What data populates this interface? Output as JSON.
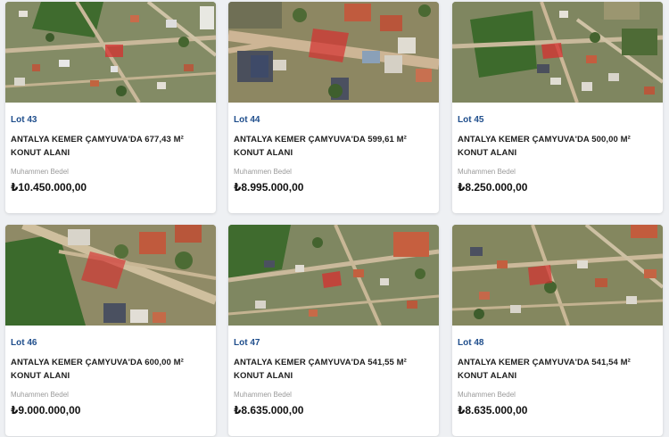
{
  "colors": {
    "lot_number": "#1f4e8c",
    "parcel_highlight": "#d62f2f",
    "background": "#eef0f3"
  },
  "lots": [
    {
      "lot": "Lot 43",
      "title": "ANTALYA KEMER ÇAMYUVA'DA 677,43 M² KONUT ALANI",
      "label": "Muhammen Bedel",
      "price": "₺10.450.000,00"
    },
    {
      "lot": "Lot 44",
      "title": "ANTALYA KEMER ÇAMYUVA'DA 599,61 M² KONUT ALANI",
      "label": "Muhammen Bedel",
      "price": "₺8.995.000,00"
    },
    {
      "lot": "Lot 45",
      "title": "ANTALYA KEMER ÇAMYUVA'DA 500,00 M² KONUT ALANI",
      "label": "Muhammen Bedel",
      "price": "₺8.250.000,00"
    },
    {
      "lot": "Lot 46",
      "title": "ANTALYA KEMER ÇAMYUVA'DA 600,00 M² KONUT ALANI",
      "label": "Muhammen Bedel",
      "price": "₺9.000.000,00"
    },
    {
      "lot": "Lot 47",
      "title": "ANTALYA KEMER ÇAMYUVA'DA 541,55 M² KONUT ALANI",
      "label": "Muhammen Bedel",
      "price": "₺8.635.000,00"
    },
    {
      "lot": "Lot 48",
      "title": "ANTALYA KEMER ÇAMYUVA'DA 541,54 M² KONUT ALANI",
      "label": "Muhammen Bedel",
      "price": "₺8.635.000,00"
    }
  ]
}
